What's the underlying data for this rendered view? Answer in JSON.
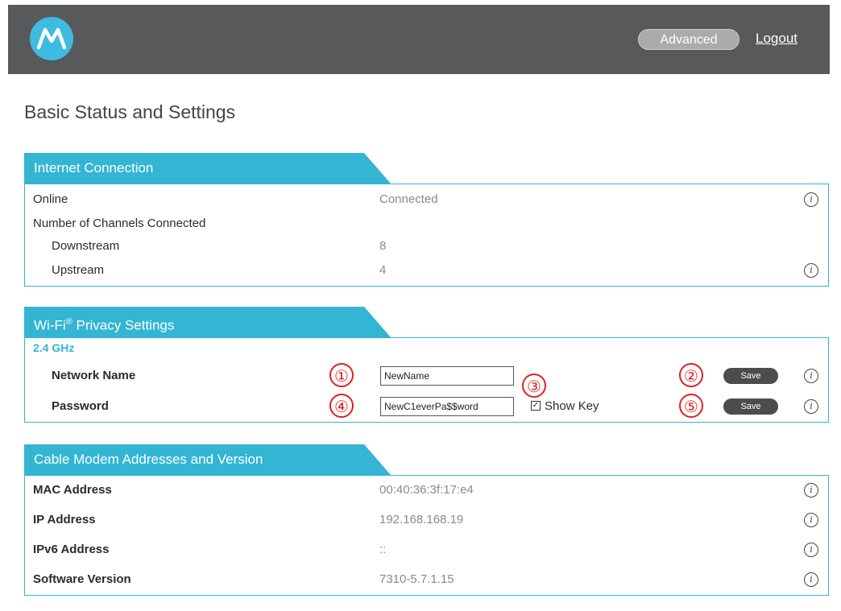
{
  "header": {
    "advanced_label": "Advanced",
    "logout_label": "Logout",
    "logo_icon": "motorola-logo-icon"
  },
  "page": {
    "title": "Basic Status and Settings"
  },
  "internet": {
    "title": "Internet Connection",
    "rows": [
      {
        "label": "Online",
        "value": "Connected"
      },
      {
        "label": "Number of Channels Connected",
        "value": ""
      },
      {
        "label": "Downstream",
        "value": "8"
      },
      {
        "label": "Upstream",
        "value": "4"
      }
    ]
  },
  "wifi": {
    "title_prefix": "Wi-Fi",
    "title_reg": "®",
    "title_suffix": " Privacy Settings",
    "band": "2.4 GHz",
    "network_name_label": "Network Name",
    "network_name_value": "NewName",
    "password_label": "Password",
    "password_value": "NewC1everPa$$word",
    "show_key_label": "Show Key",
    "show_key_checked": true,
    "save_label": "Save",
    "callouts": [
      "①",
      "②",
      "③",
      "④",
      "⑤"
    ]
  },
  "modem": {
    "title": "Cable Modem Addresses and Version",
    "rows": [
      {
        "label": "MAC Address",
        "value": "00:40:36:3f:17:e4"
      },
      {
        "label": "IP Address",
        "value": "192.168.168.19"
      },
      {
        "label": "IPv6 Address",
        "value": "::"
      },
      {
        "label": "Software Version",
        "value": "7310-5.7.1.15"
      }
    ]
  },
  "colors": {
    "accent": "#33b5d3",
    "header_bg": "#58595b",
    "callout": "#e02020"
  }
}
